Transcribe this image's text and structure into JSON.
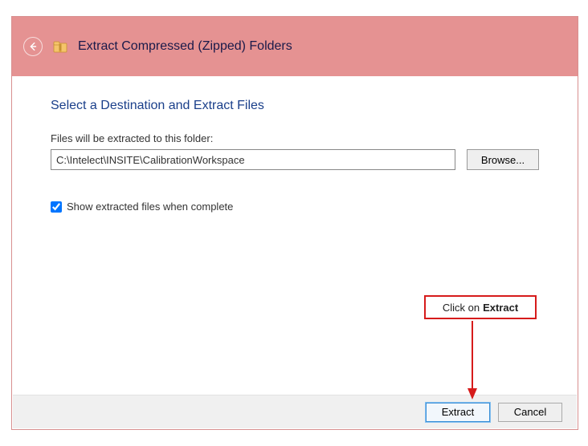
{
  "window": {
    "title": "Extract Compressed (Zipped) Folders"
  },
  "heading": "Select a Destination and Extract Files",
  "extract_label": "Files will be extracted to this folder:",
  "path_value": "C:\\Intelect\\INSITE\\CalibrationWorkspace",
  "browse_label": "Browse...",
  "show_checkbox_label": "Show extracted files when complete",
  "footer": {
    "extract": "Extract",
    "cancel": "Cancel"
  },
  "callout": {
    "prefix": "Click on ",
    "strong": "Extract"
  }
}
